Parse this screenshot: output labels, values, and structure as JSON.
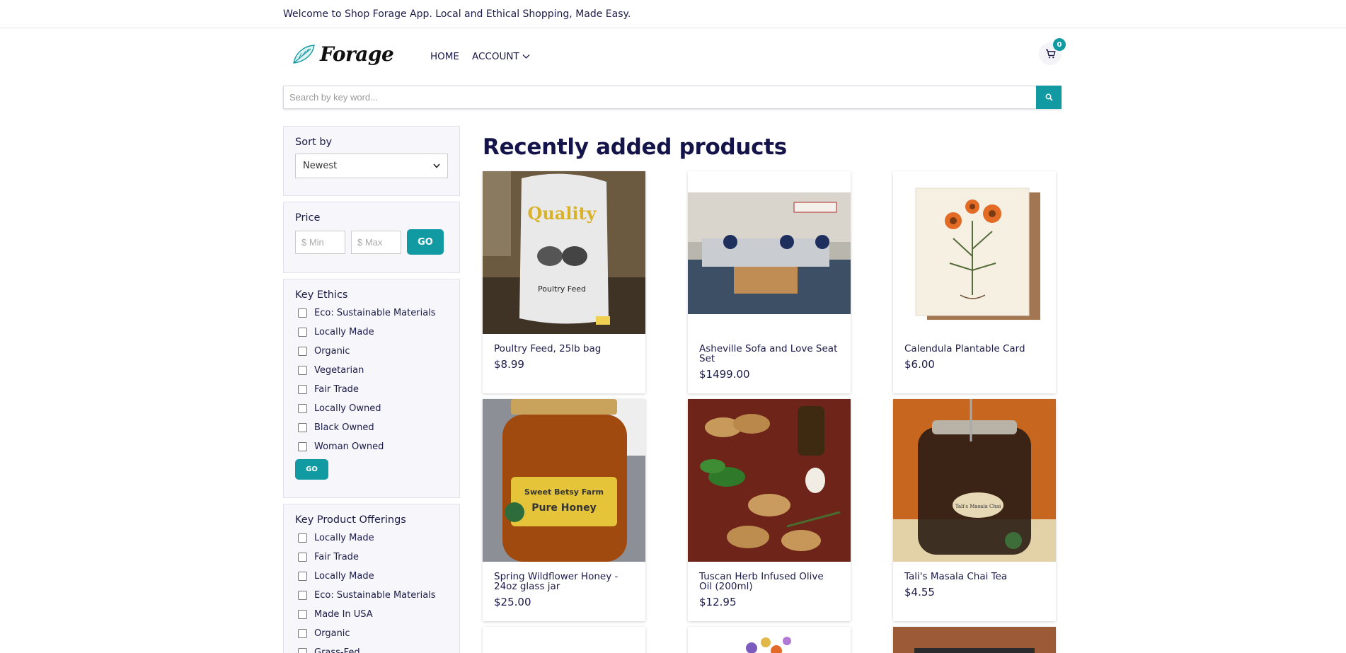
{
  "topbar": {
    "text": "Welcome to Shop Forage App. Local and Ethical Shopping, Made Easy."
  },
  "header": {
    "logo_text": "Forage",
    "nav": {
      "home": "HOME",
      "account": "ACCOUNT"
    },
    "cart_count": "0"
  },
  "search": {
    "placeholder": "Search by key word..."
  },
  "sidebar": {
    "sort": {
      "title": "Sort by",
      "selected": "Newest"
    },
    "price": {
      "title": "Price",
      "min_placeholder": "$ Min",
      "max_placeholder": "$ Max",
      "go": "GO"
    },
    "ethics": {
      "title": "Key Ethics",
      "items": [
        "Eco: Sustainable Materials",
        "Locally Made",
        "Organic",
        "Vegetarian",
        "Fair Trade",
        "Locally Owned",
        "Black Owned",
        "Woman Owned"
      ],
      "go": "GO"
    },
    "offerings": {
      "title": "Key Product Offerings",
      "items": [
        "Locally Made",
        "Fair Trade",
        "Locally Made",
        "Eco: Sustainable Materials",
        "Made In USA",
        "Organic",
        "Grass-Fed"
      ]
    }
  },
  "main": {
    "title": "Recently added products",
    "products": [
      {
        "name": "Poultry Feed, 25lb bag",
        "price": "$8.99"
      },
      {
        "name": "Asheville Sofa and Love Seat Set",
        "price": "$1499.00"
      },
      {
        "name": "Calendula Plantable Card",
        "price": "$6.00"
      },
      {
        "name": "Spring Wildflower Honey - 24oz glass jar",
        "price": "$25.00"
      },
      {
        "name": "Tuscan Herb Infused Olive Oil (200ml)",
        "price": "$12.95"
      },
      {
        "name": "Tali's Masala Chai Tea",
        "price": "$4.55"
      }
    ]
  },
  "colors": {
    "accent": "#129aa3",
    "heading": "#14134a",
    "panel_bg": "#f6f6fb"
  }
}
